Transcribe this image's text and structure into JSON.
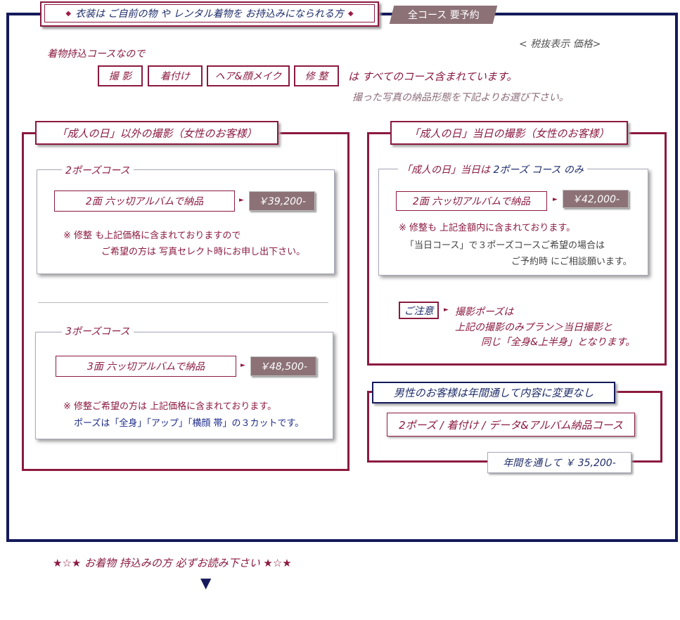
{
  "header": {
    "diamond": "◆",
    "banner": "衣装は ご自前の物 や レンタル着物を お持込みになられる方",
    "reserve": "全コース 要予約"
  },
  "tax_note": "< 税抜表示 価格>",
  "kimono_course": "着物持込コースなので",
  "services": [
    "撮 影",
    "着付け",
    "ヘア&顔メイク",
    "修 整"
  ],
  "included_text": "は すべてのコース含まれています。",
  "choose_text": "撮った写真の納品形態を下記よりお選び下さい。",
  "left_panel": {
    "title": "「成人の日」以外の撮影（女性のお客様）",
    "two_pose": {
      "legend": "2ポーズコース",
      "delivery": "2面 六ッ切アルバムで納品",
      "price": "￥39,200-",
      "note1": "※ 修整 も上記価格に含まれておりますので",
      "note2": "ご希望の方は 写真セレクト時にお申し出下さい。"
    },
    "three_pose": {
      "legend": "3ポーズコース",
      "delivery": "3面 六ッ切アルバムで納品",
      "price": "￥48,500-",
      "note1": "※ 修整ご希望の方は 上記価格に含まれております。",
      "note2": "ポーズは「全身」「アップ」「横顔 帯」の３カットです。"
    }
  },
  "right_panel": {
    "title": "「成人の日」当日の撮影（女性のお客様）",
    "legend_a": "「成人の日」当日は",
    "legend_b": "2ポーズ コース のみ",
    "delivery": "2面 六ッ切アルバムで納品",
    "price": "￥42,000-",
    "note1": "※ 修整も 上記金額内に含まれております。",
    "note2": "「当日コース」で３ポーズコースご希望の場合は",
    "note3": "ご予約時 にご相談願います。",
    "caution_label": "ご注意",
    "caution1": "撮影ポーズは",
    "caution2": "上記の撮影のみプラン＞当日撮影と",
    "caution3": "同じ「全身&上半身」となります。"
  },
  "men_panel": {
    "title": "男性のお客様は年間通して内容に変更なし",
    "course": "2ポーズ / 着付け / データ&アルバム納品コース",
    "price": "年間を通して ￥ 35,200-"
  },
  "arrow_glyph": "►",
  "footer": {
    "note": "★☆★ お着物 持込みの方 必ずお読み下さい ★☆★",
    "triangle": "▼"
  },
  "colors": {
    "navy": "#141a5a",
    "crimson": "#8b1a3f",
    "mauve": "#8c7277"
  }
}
